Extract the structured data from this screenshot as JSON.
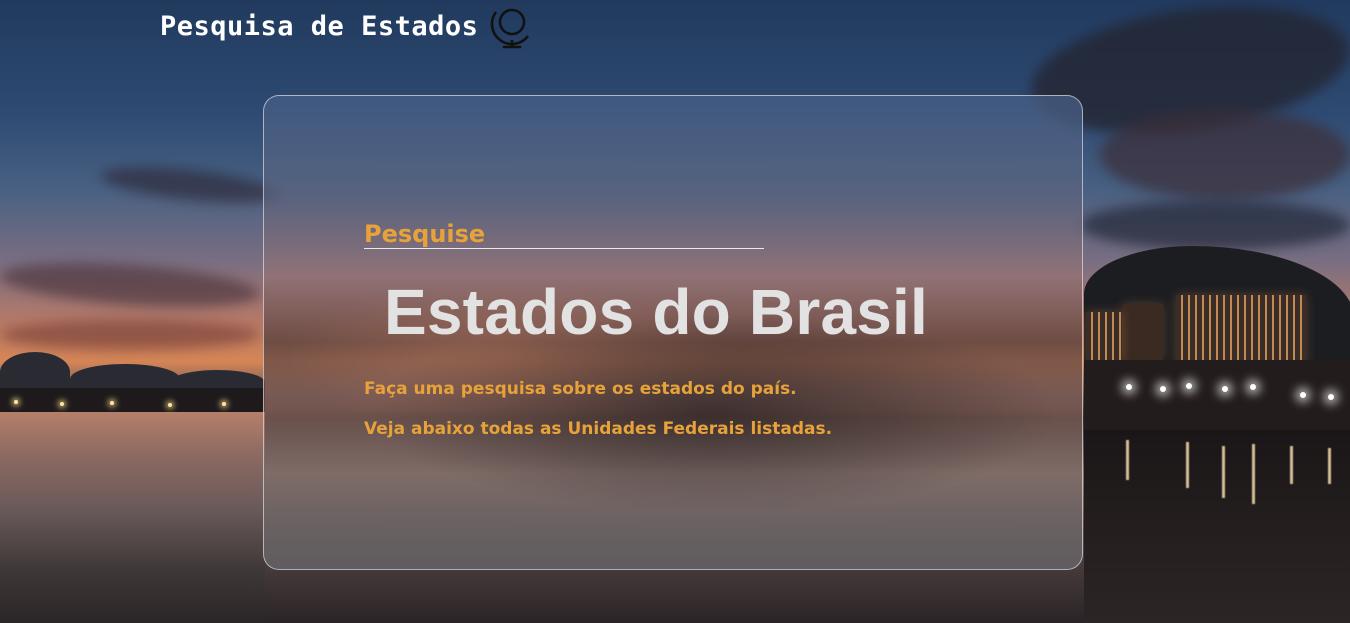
{
  "header": {
    "title": "Pesquisa de Estados",
    "icon": "globe-icon"
  },
  "card": {
    "eyebrow": "Pesquise",
    "headline": "Estados do Brasil",
    "descriptions": [
      "Faça uma pesquisa sobre os estados do país.",
      "Veja abaixo todas as Unidades Federais listadas."
    ]
  },
  "colors": {
    "accent": "#e8a23a",
    "headline": "#e2e2e2",
    "title": "#ffffff"
  }
}
